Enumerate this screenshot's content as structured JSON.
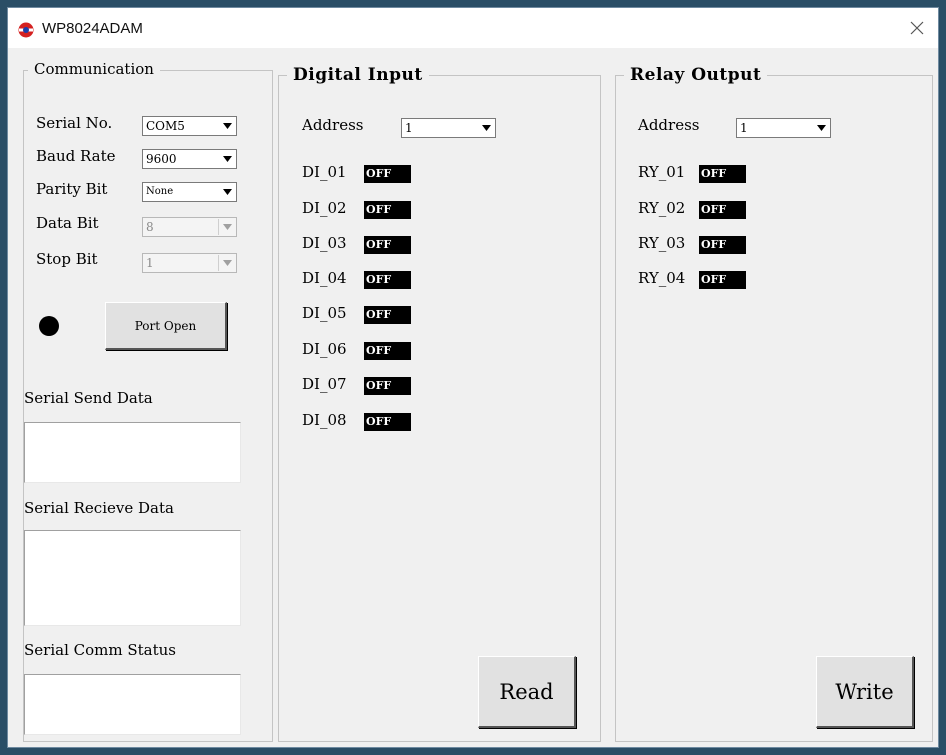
{
  "window": {
    "title": "WP8024ADAM"
  },
  "communication": {
    "legend": "Communication",
    "serial_no": {
      "label": "Serial No.",
      "value": "COM5"
    },
    "baud_rate": {
      "label": "Baud Rate",
      "value": "9600"
    },
    "parity_bit": {
      "label": "Parity Bit",
      "value": "None"
    },
    "data_bit": {
      "label": "Data Bit",
      "value": "8"
    },
    "stop_bit": {
      "label": "Stop Bit",
      "value": "1"
    },
    "port_button": "Port Open",
    "send_label": "Serial Send Data",
    "receive_label": "Serial Recieve Data",
    "status_label": "Serial Comm Status"
  },
  "digital_input": {
    "legend": "Digital Input",
    "address_label": "Address",
    "address_value": "1",
    "channels": [
      {
        "name": "DI_01",
        "state": "OFF"
      },
      {
        "name": "DI_02",
        "state": "OFF"
      },
      {
        "name": "DI_03",
        "state": "OFF"
      },
      {
        "name": "DI_04",
        "state": "OFF"
      },
      {
        "name": "DI_05",
        "state": "OFF"
      },
      {
        "name": "DI_06",
        "state": "OFF"
      },
      {
        "name": "DI_07",
        "state": "OFF"
      },
      {
        "name": "DI_08",
        "state": "OFF"
      }
    ],
    "read_button": "Read"
  },
  "relay_output": {
    "legend": "Relay Output",
    "address_label": "Address",
    "address_value": "1",
    "channels": [
      {
        "name": "RY_01",
        "state": "OFF"
      },
      {
        "name": "RY_02",
        "state": "OFF"
      },
      {
        "name": "RY_03",
        "state": "OFF"
      },
      {
        "name": "RY_04",
        "state": "OFF"
      }
    ],
    "write_button": "Write"
  },
  "colors": {
    "desktop": "#2a4e66",
    "window_bg": "#f0f0f0",
    "led_off": "#000000",
    "state_bg": "#000000",
    "state_fg": "#ffffff"
  }
}
